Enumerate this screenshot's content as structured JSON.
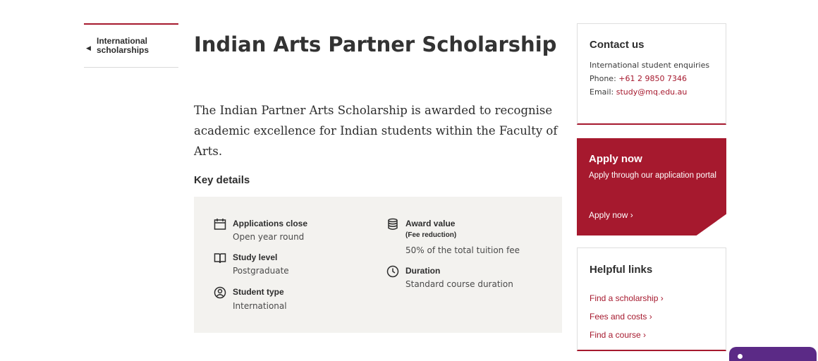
{
  "nav": {
    "back_label": "International scholarships"
  },
  "page": {
    "title": "Indian Arts Partner Scholarship",
    "intro": "The Indian Partner Arts Scholarship is awarded to recognise academic excellence for Indian students within the Faculty of Arts."
  },
  "key_details": {
    "heading": "Key details",
    "applications_close": {
      "label": "Applications close",
      "value": "Open year round",
      "icon": "calendar-icon"
    },
    "study_level": {
      "label": "Study level",
      "value": "Postgraduate",
      "icon": "book-icon"
    },
    "student_type": {
      "label": "Student type",
      "value": "International",
      "icon": "user-circle-icon"
    },
    "award_value": {
      "label": "Award value",
      "sub": "(Fee reduction)",
      "value": "50% of the total tuition fee",
      "icon": "database-icon"
    },
    "duration": {
      "label": "Duration",
      "value": "Standard course duration",
      "icon": "clock-icon"
    }
  },
  "contact": {
    "title": "Contact us",
    "line1": "International student enquiries",
    "phone_label": "Phone: ",
    "phone": "+61 2 9850 7346",
    "email_label": "Email: ",
    "email": "study@mq.edu.au"
  },
  "apply": {
    "title": "Apply now",
    "text": "Apply through our application portal",
    "link": "Apply now ›"
  },
  "helpful": {
    "title": "Helpful links",
    "links": [
      "Find a scholarship ›",
      "Fees and costs ›",
      "Find a course ›"
    ]
  },
  "colors": {
    "accent": "#a6192e",
    "panel": "#f3f2ef",
    "chat": "#5b2a86"
  }
}
